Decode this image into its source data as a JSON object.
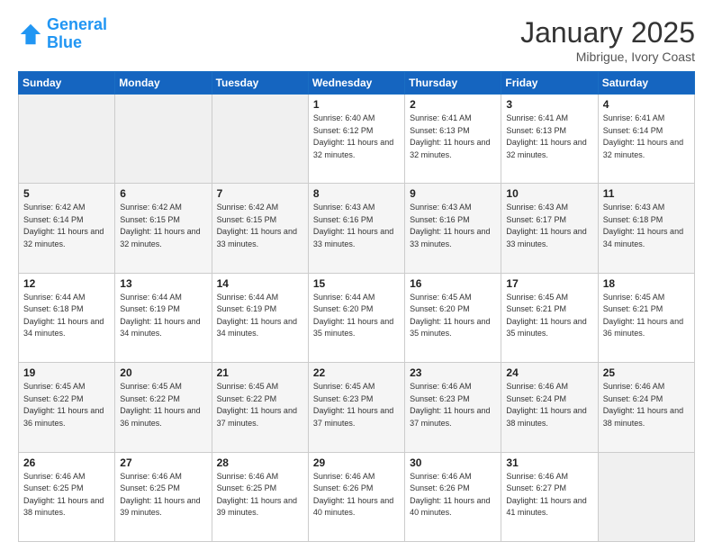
{
  "header": {
    "logo_line1": "General",
    "logo_line2": "Blue",
    "title": "January 2025",
    "subtitle": "Mibrigue, Ivory Coast"
  },
  "days_of_week": [
    "Sunday",
    "Monday",
    "Tuesday",
    "Wednesday",
    "Thursday",
    "Friday",
    "Saturday"
  ],
  "weeks": [
    [
      {
        "day": "",
        "sunrise": "",
        "sunset": "",
        "daylight": "",
        "empty": true
      },
      {
        "day": "",
        "sunrise": "",
        "sunset": "",
        "daylight": "",
        "empty": true
      },
      {
        "day": "",
        "sunrise": "",
        "sunset": "",
        "daylight": "",
        "empty": true
      },
      {
        "day": "1",
        "sunrise": "Sunrise: 6:40 AM",
        "sunset": "Sunset: 6:12 PM",
        "daylight": "Daylight: 11 hours and 32 minutes."
      },
      {
        "day": "2",
        "sunrise": "Sunrise: 6:41 AM",
        "sunset": "Sunset: 6:13 PM",
        "daylight": "Daylight: 11 hours and 32 minutes."
      },
      {
        "day": "3",
        "sunrise": "Sunrise: 6:41 AM",
        "sunset": "Sunset: 6:13 PM",
        "daylight": "Daylight: 11 hours and 32 minutes."
      },
      {
        "day": "4",
        "sunrise": "Sunrise: 6:41 AM",
        "sunset": "Sunset: 6:14 PM",
        "daylight": "Daylight: 11 hours and 32 minutes."
      }
    ],
    [
      {
        "day": "5",
        "sunrise": "Sunrise: 6:42 AM",
        "sunset": "Sunset: 6:14 PM",
        "daylight": "Daylight: 11 hours and 32 minutes."
      },
      {
        "day": "6",
        "sunrise": "Sunrise: 6:42 AM",
        "sunset": "Sunset: 6:15 PM",
        "daylight": "Daylight: 11 hours and 32 minutes."
      },
      {
        "day": "7",
        "sunrise": "Sunrise: 6:42 AM",
        "sunset": "Sunset: 6:15 PM",
        "daylight": "Daylight: 11 hours and 33 minutes."
      },
      {
        "day": "8",
        "sunrise": "Sunrise: 6:43 AM",
        "sunset": "Sunset: 6:16 PM",
        "daylight": "Daylight: 11 hours and 33 minutes."
      },
      {
        "day": "9",
        "sunrise": "Sunrise: 6:43 AM",
        "sunset": "Sunset: 6:16 PM",
        "daylight": "Daylight: 11 hours and 33 minutes."
      },
      {
        "day": "10",
        "sunrise": "Sunrise: 6:43 AM",
        "sunset": "Sunset: 6:17 PM",
        "daylight": "Daylight: 11 hours and 33 minutes."
      },
      {
        "day": "11",
        "sunrise": "Sunrise: 6:43 AM",
        "sunset": "Sunset: 6:18 PM",
        "daylight": "Daylight: 11 hours and 34 minutes."
      }
    ],
    [
      {
        "day": "12",
        "sunrise": "Sunrise: 6:44 AM",
        "sunset": "Sunset: 6:18 PM",
        "daylight": "Daylight: 11 hours and 34 minutes."
      },
      {
        "day": "13",
        "sunrise": "Sunrise: 6:44 AM",
        "sunset": "Sunset: 6:19 PM",
        "daylight": "Daylight: 11 hours and 34 minutes."
      },
      {
        "day": "14",
        "sunrise": "Sunrise: 6:44 AM",
        "sunset": "Sunset: 6:19 PM",
        "daylight": "Daylight: 11 hours and 34 minutes."
      },
      {
        "day": "15",
        "sunrise": "Sunrise: 6:44 AM",
        "sunset": "Sunset: 6:20 PM",
        "daylight": "Daylight: 11 hours and 35 minutes."
      },
      {
        "day": "16",
        "sunrise": "Sunrise: 6:45 AM",
        "sunset": "Sunset: 6:20 PM",
        "daylight": "Daylight: 11 hours and 35 minutes."
      },
      {
        "day": "17",
        "sunrise": "Sunrise: 6:45 AM",
        "sunset": "Sunset: 6:21 PM",
        "daylight": "Daylight: 11 hours and 35 minutes."
      },
      {
        "day": "18",
        "sunrise": "Sunrise: 6:45 AM",
        "sunset": "Sunset: 6:21 PM",
        "daylight": "Daylight: 11 hours and 36 minutes."
      }
    ],
    [
      {
        "day": "19",
        "sunrise": "Sunrise: 6:45 AM",
        "sunset": "Sunset: 6:22 PM",
        "daylight": "Daylight: 11 hours and 36 minutes."
      },
      {
        "day": "20",
        "sunrise": "Sunrise: 6:45 AM",
        "sunset": "Sunset: 6:22 PM",
        "daylight": "Daylight: 11 hours and 36 minutes."
      },
      {
        "day": "21",
        "sunrise": "Sunrise: 6:45 AM",
        "sunset": "Sunset: 6:22 PM",
        "daylight": "Daylight: 11 hours and 37 minutes."
      },
      {
        "day": "22",
        "sunrise": "Sunrise: 6:45 AM",
        "sunset": "Sunset: 6:23 PM",
        "daylight": "Daylight: 11 hours and 37 minutes."
      },
      {
        "day": "23",
        "sunrise": "Sunrise: 6:46 AM",
        "sunset": "Sunset: 6:23 PM",
        "daylight": "Daylight: 11 hours and 37 minutes."
      },
      {
        "day": "24",
        "sunrise": "Sunrise: 6:46 AM",
        "sunset": "Sunset: 6:24 PM",
        "daylight": "Daylight: 11 hours and 38 minutes."
      },
      {
        "day": "25",
        "sunrise": "Sunrise: 6:46 AM",
        "sunset": "Sunset: 6:24 PM",
        "daylight": "Daylight: 11 hours and 38 minutes."
      }
    ],
    [
      {
        "day": "26",
        "sunrise": "Sunrise: 6:46 AM",
        "sunset": "Sunset: 6:25 PM",
        "daylight": "Daylight: 11 hours and 38 minutes."
      },
      {
        "day": "27",
        "sunrise": "Sunrise: 6:46 AM",
        "sunset": "Sunset: 6:25 PM",
        "daylight": "Daylight: 11 hours and 39 minutes."
      },
      {
        "day": "28",
        "sunrise": "Sunrise: 6:46 AM",
        "sunset": "Sunset: 6:25 PM",
        "daylight": "Daylight: 11 hours and 39 minutes."
      },
      {
        "day": "29",
        "sunrise": "Sunrise: 6:46 AM",
        "sunset": "Sunset: 6:26 PM",
        "daylight": "Daylight: 11 hours and 40 minutes."
      },
      {
        "day": "30",
        "sunrise": "Sunrise: 6:46 AM",
        "sunset": "Sunset: 6:26 PM",
        "daylight": "Daylight: 11 hours and 40 minutes."
      },
      {
        "day": "31",
        "sunrise": "Sunrise: 6:46 AM",
        "sunset": "Sunset: 6:27 PM",
        "daylight": "Daylight: 11 hours and 41 minutes."
      },
      {
        "day": "",
        "sunrise": "",
        "sunset": "",
        "daylight": "",
        "empty": true
      }
    ]
  ]
}
